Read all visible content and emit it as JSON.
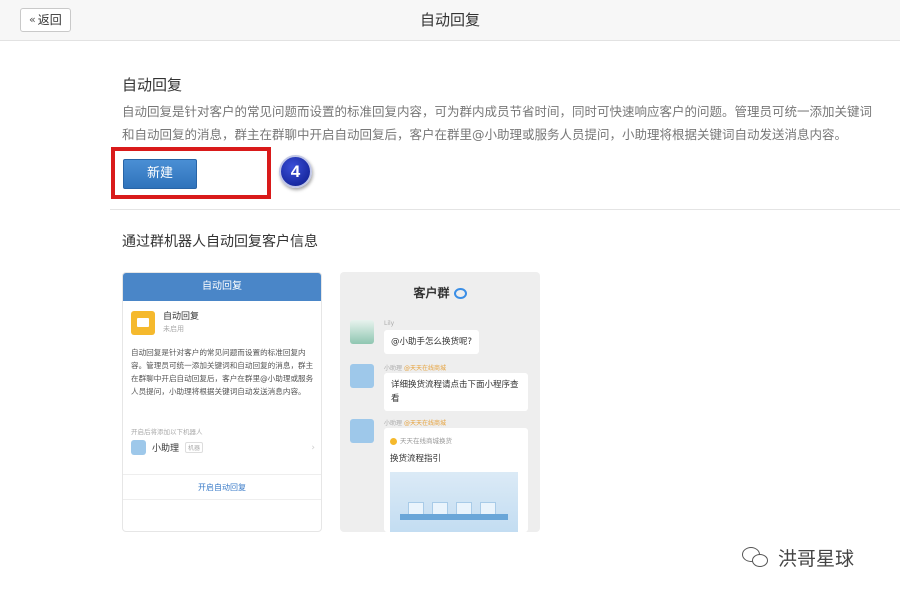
{
  "topbar": {
    "back_label": "返回",
    "title": "自动回复"
  },
  "section": {
    "title": "自动回复",
    "desc_line1": "自动回复是针对客户的常见问题而设置的标准回复内容，可为群内成员节省时间，同时可快速响应客户的问题。管理员可统一添加关键词",
    "desc_line2": "和自动回复的消息，群主在群聊中开启自动回复后，客户在群里@小助理或服务人员提问，小助理将根据关键词自动发送消息内容。",
    "new_button": "新建",
    "step_number": "4"
  },
  "robot_section": {
    "title": "通过群机器人自动回复客户信息"
  },
  "preview_left": {
    "header": "自动回复",
    "app_name": "自动回复",
    "app_status": "未启用",
    "body": "自动回复是针对客户的常见问题而设置的标准回复内容。管理员可统一添加关键词和自动回复的消息，群主在群聊中开启自动回复后，客户在群里@小助理或服务人员提问，小助理将根据关键词自动发送消息内容。",
    "robot_hint": "开启后将添加以下机器人",
    "robot_name": "小助理",
    "robot_tag": "机器",
    "enable_label": "开启自动回复"
  },
  "preview_right": {
    "title": "客户群",
    "msg1_nick": "Lily",
    "msg1_text": "@小助手怎么换货呢?",
    "msg2_nick": "小助理",
    "msg2_group": "@天天在线商城",
    "msg2_text": "详细换货流程请点击下面小程序查看",
    "msg3_nick": "小助理",
    "msg3_group": "@天天在线商城",
    "msg3_shop": "天天在线商城换货",
    "msg3_title": "换货流程指引"
  },
  "watermark": {
    "text": "洪哥星球"
  },
  "icons": {
    "back": "chevron-double-left-icon",
    "chat": "chat-bubble-icon",
    "wechat": "wechat-icon"
  },
  "colors": {
    "primary_button": "#3a7fc6",
    "highlight": "#d91a1a",
    "step_badge": "#1a2aa8"
  }
}
